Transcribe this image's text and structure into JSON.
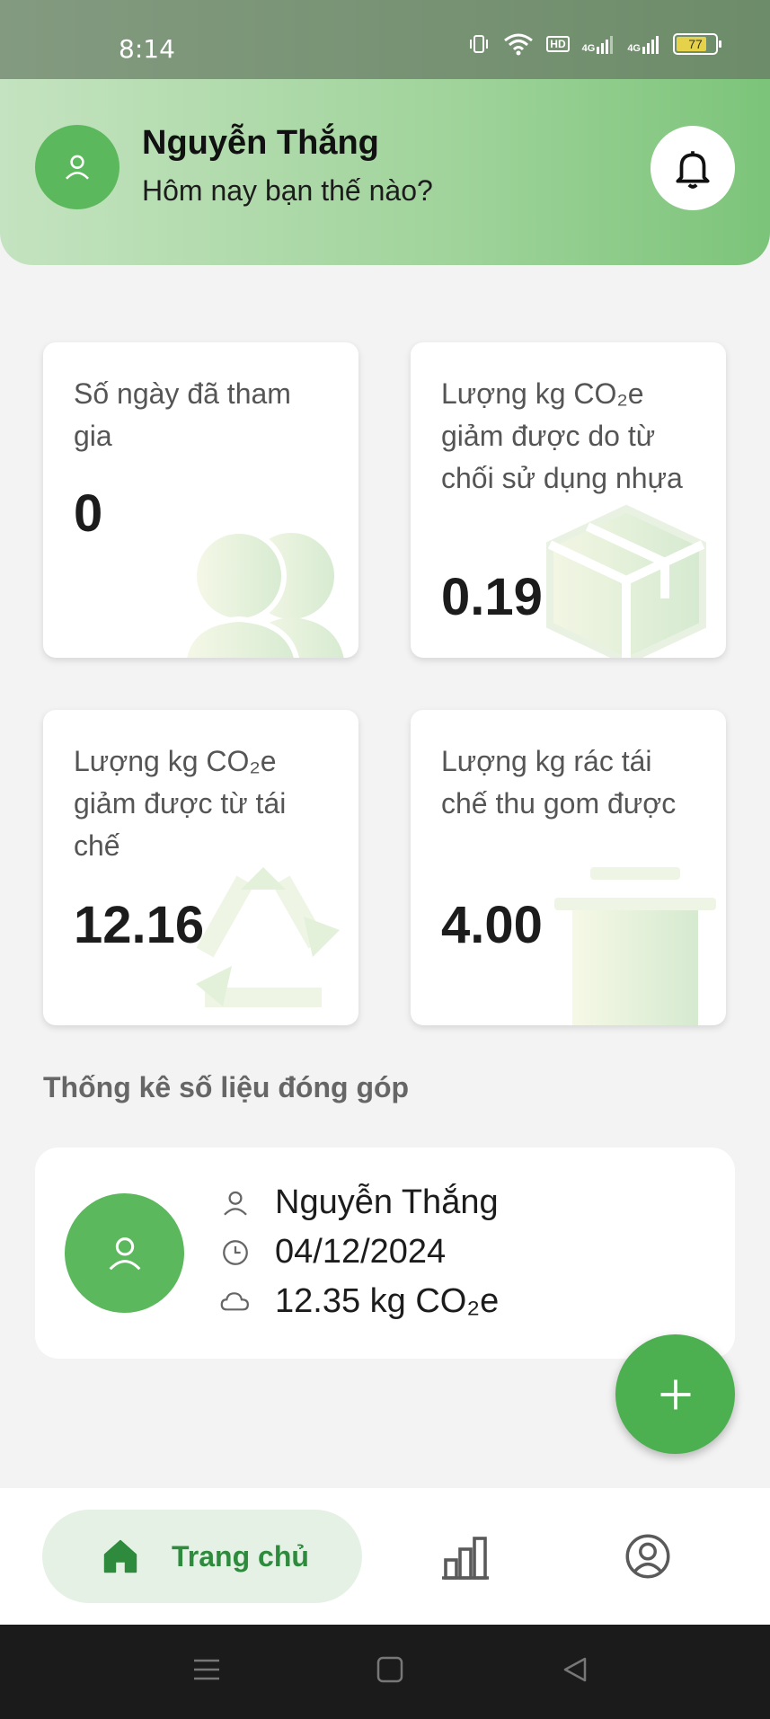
{
  "status_bar": {
    "time": "8:14",
    "hd_label": "HD",
    "signal_1": "4G",
    "signal_2": "4G",
    "battery": "77"
  },
  "header": {
    "name": "Nguyễn Thắng",
    "greeting": "Hôm nay bạn thế nào?"
  },
  "stats": [
    {
      "label": "Số ngày đã tham gia",
      "value": "0",
      "bg_icon": "people-icon"
    },
    {
      "label": "Lượng kg CO₂e giảm được do từ chối sử dụng nhựa",
      "value": "0.19",
      "bg_icon": "box-icon"
    },
    {
      "label": "Lượng kg CO₂e giảm được từ tái chế",
      "value": "12.16",
      "bg_icon": "recycle-icon"
    },
    {
      "label": "Lượng kg rác tái chế thu gom được",
      "value": "4.00",
      "bg_icon": "bin-icon"
    }
  ],
  "section_title": "Thống kê số liệu đóng góp",
  "contribution": {
    "name": "Nguyễn Thắng",
    "date": "04/12/2024",
    "amount": "12.35 kg CO₂e"
  },
  "bottom_nav": {
    "home_label": "Trang chủ"
  },
  "colors": {
    "primary": "#4caf50",
    "avatar": "#5cb85c",
    "nav_active_bg": "#e6f1e6",
    "nav_active_text": "#2e8b3d"
  }
}
